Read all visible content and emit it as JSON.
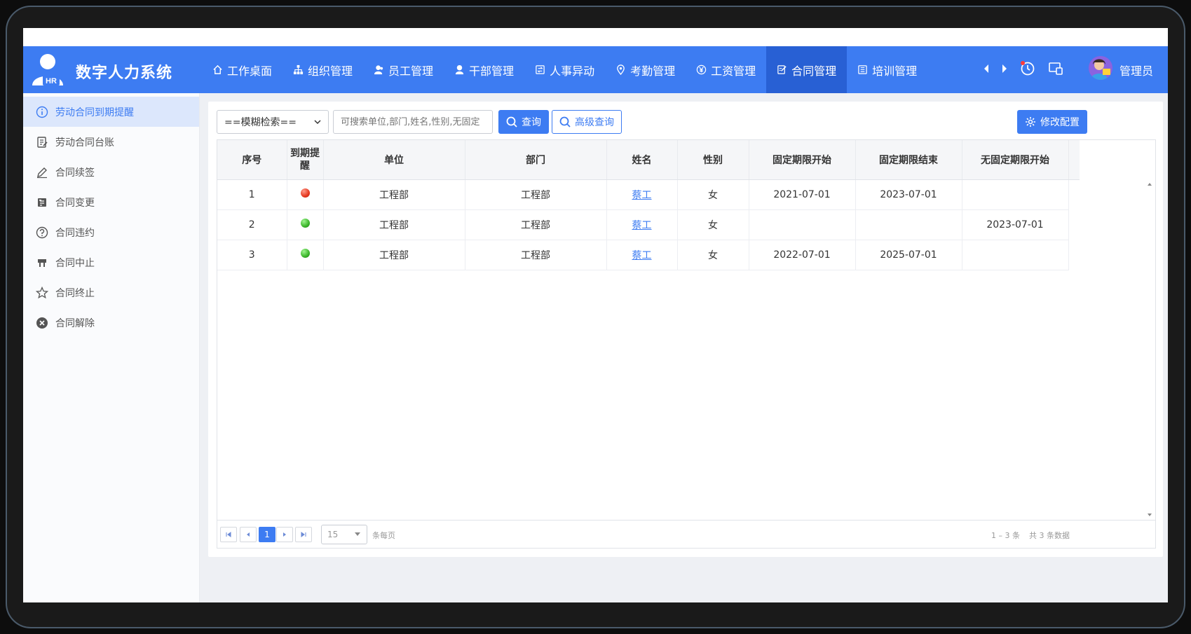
{
  "app": {
    "title": "数字人力系统",
    "logo_text": "HR"
  },
  "nav": {
    "items": [
      {
        "label": "工作桌面",
        "icon": "home-icon"
      },
      {
        "label": "组织管理",
        "icon": "org-icon"
      },
      {
        "label": "员工管理",
        "icon": "users-icon"
      },
      {
        "label": "干部管理",
        "icon": "user-icon"
      },
      {
        "label": "人事异动",
        "icon": "transfer-icon"
      },
      {
        "label": "考勤管理",
        "icon": "location-icon"
      },
      {
        "label": "工资管理",
        "icon": "yen-icon"
      },
      {
        "label": "合同管理",
        "icon": "contract-icon",
        "active": true
      },
      {
        "label": "培训管理",
        "icon": "training-icon"
      }
    ],
    "user_name": "管理员"
  },
  "sidebar": {
    "items": [
      {
        "label": "劳动合同到期提醒",
        "icon": "info-icon",
        "active": true
      },
      {
        "label": "劳动合同台账",
        "icon": "ledger-icon"
      },
      {
        "label": "合同续签",
        "icon": "edit-icon"
      },
      {
        "label": "合同变更",
        "icon": "change-icon"
      },
      {
        "label": "合同违约",
        "icon": "question-icon"
      },
      {
        "label": "合同中止",
        "icon": "pause-icon"
      },
      {
        "label": "合同终止",
        "icon": "star-icon"
      },
      {
        "label": "合同解除",
        "icon": "close-circle-icon"
      }
    ]
  },
  "toolbar": {
    "search_mode": "==模糊检索==",
    "search_placeholder": "可搜索单位,部门,姓名,性别,无固定",
    "query_label": "查询",
    "advanced_label": "高级查询",
    "config_label": "修改配置"
  },
  "table": {
    "headers": [
      "序号",
      "到期提醒",
      "单位",
      "部门",
      "姓名",
      "性别",
      "固定期限开始",
      "固定期限结束",
      "无固定期限开始"
    ],
    "header_remind_line1": "到期提",
    "header_remind_line2": "醒",
    "rows": [
      {
        "no": "1",
        "remind": "red",
        "unit": "工程部",
        "dept": "工程部",
        "name": "蔡工",
        "gender": "女",
        "fixed_start": "2021-07-01",
        "fixed_end": "2023-07-01",
        "open_start": ""
      },
      {
        "no": "2",
        "remind": "green",
        "unit": "工程部",
        "dept": "工程部",
        "name": "蔡工",
        "gender": "女",
        "fixed_start": "",
        "fixed_end": "",
        "open_start": "2023-07-01"
      },
      {
        "no": "3",
        "remind": "green",
        "unit": "工程部",
        "dept": "工程部",
        "name": "蔡工",
        "gender": "女",
        "fixed_start": "2022-07-01",
        "fixed_end": "2025-07-01",
        "open_start": ""
      }
    ]
  },
  "pager": {
    "current_page": "1",
    "page_size": "15",
    "page_size_suffix": "条每页",
    "range_text": "1 – 3 条",
    "total_text": "共 3 条数据"
  },
  "colors": {
    "primary": "#3d7cf2",
    "nav_active": "#2860d4",
    "sidebar_active": "#dce7fc"
  }
}
